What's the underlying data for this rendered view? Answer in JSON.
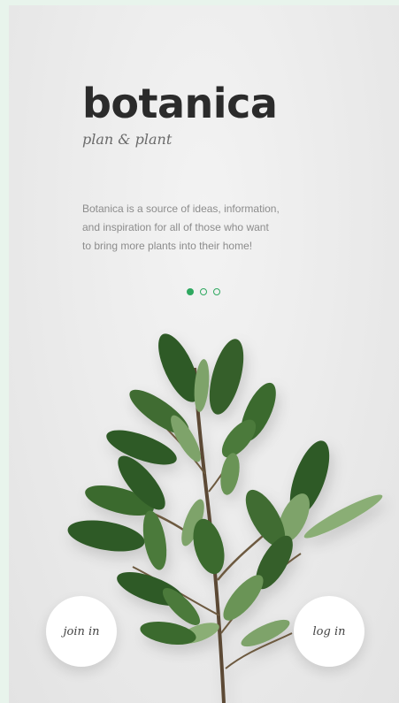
{
  "brand": {
    "title": "botanica",
    "tagline": "plan & plant"
  },
  "intro": {
    "line1": "Botanica is a source of ideas, information,",
    "line2": "and inspiration for all of those who want",
    "line3": "to bring more plants into their home!"
  },
  "pager": {
    "total": 3,
    "active_index": 0
  },
  "buttons": {
    "join_label": "join in",
    "login_label": "log in"
  },
  "colors": {
    "accent": "#2fa860",
    "leaf_dark": "#2f5a26",
    "leaf_mid": "#4c7a3b",
    "leaf_light": "#7ea36a"
  }
}
